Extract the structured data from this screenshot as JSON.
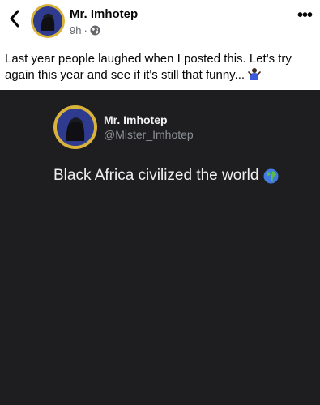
{
  "header": {
    "author_name": "Mr. Imhotep",
    "time": "9h",
    "separator": "·",
    "privacy_icon": "globe-icon",
    "back_icon": "chevron-left-icon",
    "more_icon": "more-horizontal-icon",
    "more_glyph": "•••"
  },
  "post": {
    "text": "Last year people laughed when I posted this. Let's try again this year and see if it's still that funny...",
    "emoji": "person-shrugging-emoji"
  },
  "tweet": {
    "name": "Mr. Imhotep",
    "handle": "@Mister_Imhotep",
    "text": "Black Africa civilized the world",
    "emoji": "globe-emoji"
  },
  "colors": {
    "card_background": "#1e1e20",
    "avatar_ring": "#d9b23a",
    "avatar_fill": "#2e3b8f"
  }
}
